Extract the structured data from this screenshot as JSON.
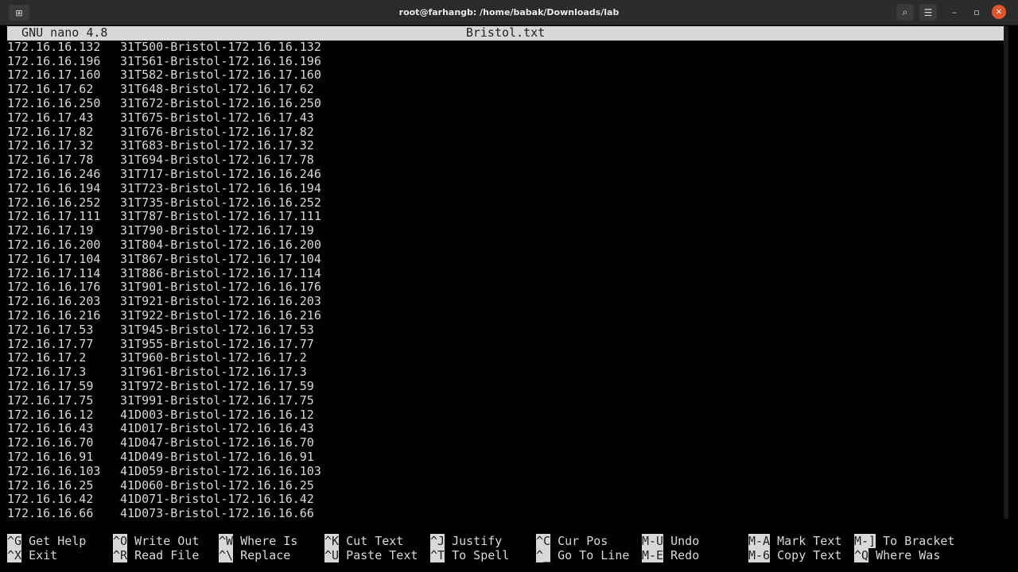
{
  "window": {
    "title": "root@farhangb: /home/babak/Downloads/lab",
    "new_tab_icon": "new-tab-icon",
    "search_icon": "search-icon",
    "menu_icon": "menu-icon",
    "minimize_glyph": "–",
    "maximize_glyph": "▫",
    "close_glyph": "✕"
  },
  "nano": {
    "app": "  GNU nano 4.8",
    "filename": "Bristol.txt"
  },
  "lines": [
    {
      "ip": "172.16.16.132",
      "host": "31T500-Bristol-172.16.16.132"
    },
    {
      "ip": "172.16.16.196",
      "host": "31T561-Bristol-172.16.16.196"
    },
    {
      "ip": "172.16.17.160",
      "host": "31T582-Bristol-172.16.17.160"
    },
    {
      "ip": "172.16.17.62",
      "host": "31T648-Bristol-172.16.17.62"
    },
    {
      "ip": "172.16.16.250",
      "host": "31T672-Bristol-172.16.16.250"
    },
    {
      "ip": "172.16.17.43",
      "host": "31T675-Bristol-172.16.17.43"
    },
    {
      "ip": "172.16.17.82",
      "host": "31T676-Bristol-172.16.17.82"
    },
    {
      "ip": "172.16.17.32",
      "host": "31T683-Bristol-172.16.17.32"
    },
    {
      "ip": "172.16.17.78",
      "host": "31T694-Bristol-172.16.17.78"
    },
    {
      "ip": "172.16.16.246",
      "host": "31T717-Bristol-172.16.16.246"
    },
    {
      "ip": "172.16.16.194",
      "host": "31T723-Bristol-172.16.16.194"
    },
    {
      "ip": "172.16.16.252",
      "host": "31T735-Bristol-172.16.16.252"
    },
    {
      "ip": "172.16.17.111",
      "host": "31T787-Bristol-172.16.17.111"
    },
    {
      "ip": "172.16.17.19",
      "host": "31T790-Bristol-172.16.17.19"
    },
    {
      "ip": "172.16.16.200",
      "host": "31T804-Bristol-172.16.16.200"
    },
    {
      "ip": "172.16.17.104",
      "host": "31T867-Bristol-172.16.17.104"
    },
    {
      "ip": "172.16.17.114",
      "host": "31T886-Bristol-172.16.17.114"
    },
    {
      "ip": "172.16.16.176",
      "host": "31T901-Bristol-172.16.16.176"
    },
    {
      "ip": "172.16.16.203",
      "host": "31T921-Bristol-172.16.16.203"
    },
    {
      "ip": "172.16.16.216",
      "host": "31T922-Bristol-172.16.16.216"
    },
    {
      "ip": "172.16.17.53",
      "host": "31T945-Bristol-172.16.17.53"
    },
    {
      "ip": "172.16.17.77",
      "host": "31T955-Bristol-172.16.17.77"
    },
    {
      "ip": "172.16.17.2",
      "host": "31T960-Bristol-172.16.17.2"
    },
    {
      "ip": "172.16.17.3",
      "host": "31T961-Bristol-172.16.17.3"
    },
    {
      "ip": "172.16.17.59",
      "host": "31T972-Bristol-172.16.17.59"
    },
    {
      "ip": "172.16.17.75",
      "host": "31T991-Bristol-172.16.17.75"
    },
    {
      "ip": "172.16.16.12",
      "host": "41D003-Bristol-172.16.16.12"
    },
    {
      "ip": "172.16.16.43",
      "host": "41D017-Bristol-172.16.16.43"
    },
    {
      "ip": "172.16.16.70",
      "host": "41D047-Bristol-172.16.16.70"
    },
    {
      "ip": "172.16.16.91",
      "host": "41D049-Bristol-172.16.16.91"
    },
    {
      "ip": "172.16.16.103",
      "host": "41D059-Bristol-172.16.16.103"
    },
    {
      "ip": "172.16.16.25",
      "host": "41D060-Bristol-172.16.16.25"
    },
    {
      "ip": "172.16.16.42",
      "host": "41D071-Bristol-172.16.16.42"
    },
    {
      "ip": "172.16.16.66",
      "host": "41D073-Bristol-172.16.16.66"
    }
  ],
  "shortcuts": {
    "row1": [
      {
        "key": "^G",
        "label": "Get Help"
      },
      {
        "key": "^O",
        "label": "Write Out"
      },
      {
        "key": "^W",
        "label": "Where Is"
      },
      {
        "key": "^K",
        "label": "Cut Text"
      },
      {
        "key": "^J",
        "label": "Justify"
      },
      {
        "key": "^C",
        "label": "Cur Pos"
      },
      {
        "key": "M-U",
        "label": "Undo"
      },
      {
        "key": "M-A",
        "label": "Mark Text"
      },
      {
        "key": "M-]",
        "label": "To Bracket"
      }
    ],
    "row2": [
      {
        "key": "^X",
        "label": "Exit"
      },
      {
        "key": "^R",
        "label": "Read File"
      },
      {
        "key": "^\\",
        "label": "Replace"
      },
      {
        "key": "^U",
        "label": "Paste Text"
      },
      {
        "key": "^T",
        "label": "To Spell"
      },
      {
        "key": "^_",
        "label": "Go To Line"
      },
      {
        "key": "M-E",
        "label": "Redo"
      },
      {
        "key": "M-6",
        "label": "Copy Text"
      },
      {
        "key": "^Q",
        "label": "Where Was"
      }
    ]
  }
}
